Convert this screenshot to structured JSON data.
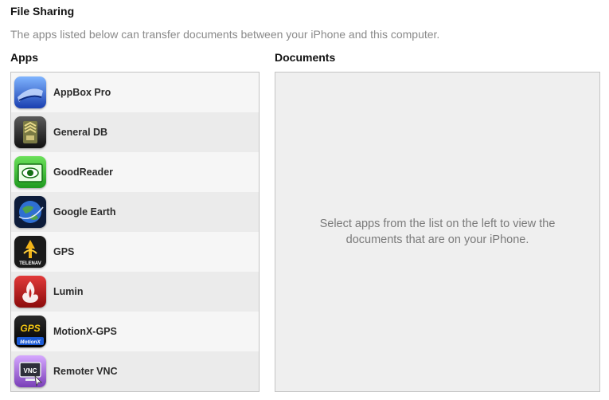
{
  "header": {
    "title": "File Sharing",
    "subtitle": "The apps listed below can transfer documents between your iPhone and this computer."
  },
  "apps_panel": {
    "heading": "Apps",
    "items": [
      {
        "label": "AppBox Pro",
        "icon": "appbox-pro-icon"
      },
      {
        "label": "General DB",
        "icon": "general-db-icon"
      },
      {
        "label": "GoodReader",
        "icon": "goodreader-icon"
      },
      {
        "label": "Google Earth",
        "icon": "google-earth-icon"
      },
      {
        "label": "GPS",
        "icon": "telenav-gps-icon",
        "icon_text": "TELENAV"
      },
      {
        "label": "Lumin",
        "icon": "lumin-icon"
      },
      {
        "label": "MotionX-GPS",
        "icon": "motionx-gps-icon",
        "icon_text": "GPS",
        "icon_subtext": "MotionX"
      },
      {
        "label": "Remoter VNC",
        "icon": "remoter-vnc-icon",
        "icon_text": "VNC"
      }
    ]
  },
  "documents_panel": {
    "heading": "Documents",
    "empty_message": "Select apps from the list on the left to view the documents that are on your iPhone."
  }
}
